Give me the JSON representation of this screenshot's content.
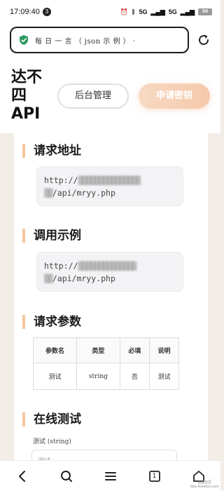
{
  "status_bar": {
    "time": "17:09:40",
    "notification_count": "3",
    "signal_1": "5G",
    "signal_2": "5G",
    "battery": "54"
  },
  "browser": {
    "url_text": "每 日 一 言 （ json 示 例 ） ·",
    "secure": true
  },
  "header": {
    "logo": "达不四API",
    "admin_button": "后台管理",
    "apply_button": "申请密钥"
  },
  "sections": {
    "request_url": {
      "title": "请求地址",
      "url_prefix": "http://",
      "url_obscured": "▒▒▒▒▒▒▒▒▒▒▒▒▒▒▒",
      "url_path_obscured": "▒▒",
      "url_suffix": "/api/mryy.php"
    },
    "call_example": {
      "title": "调用示例",
      "url_prefix": "http://",
      "url_obscured": "▒▒▒▒▒▒▒▒▒▒▒▒▒▒",
      "url_path_obscured": "▒▒",
      "url_suffix": "/api/mryy.php"
    },
    "params": {
      "title": "请求参数",
      "headers": [
        "参数名",
        "类型",
        "必填",
        "说明"
      ],
      "rows": [
        [
          "测试",
          "string",
          "否",
          "测试"
        ]
      ]
    },
    "online_test": {
      "title": "在线测试",
      "field_label": "测试 (string)",
      "field_placeholder": "测试"
    }
  },
  "watermark": {
    "line1": "强盛社区",
    "line2": "bbs.ituodsv.com"
  },
  "colors": {
    "page_bg": "#f2ede7",
    "accent": "#f4c79b",
    "apply_gradient_start": "#f7d9c3",
    "apply_gradient_end": "#f6c9ab",
    "secure_green": "#2e9b63"
  },
  "icons": {
    "secure": "shield-check-icon",
    "refresh": "refresh-icon",
    "nav_back": "chevron-left-icon",
    "nav_search": "search-icon",
    "nav_menu": "menu-icon",
    "nav_tabs": "tabs-icon",
    "nav_home": "home-icon"
  },
  "bottom_nav": {
    "tab_count": "1"
  }
}
